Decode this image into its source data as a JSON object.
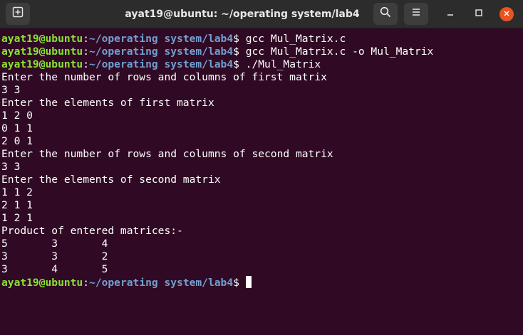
{
  "window": {
    "title": "ayat19@ubuntu: ~/operating system/lab4"
  },
  "toolbar": {
    "new_tab_icon": "new-tab-icon",
    "search_icon": "search-icon",
    "menu_icon": "hamburger-menu-icon",
    "minimize_icon": "minimize-icon",
    "maximize_icon": "maximize-icon",
    "close_icon": "close-icon",
    "close_color": "#e95420"
  },
  "prompt": {
    "user": "ayat19@ubuntu",
    "colon": ":",
    "path": "~/operating system/lab4",
    "dollar": "$ "
  },
  "colors": {
    "background": "#300a24",
    "prompt_user": "#8ae234",
    "prompt_path": "#729fcf",
    "text": "#ffffff"
  },
  "terminal": {
    "lines": [
      {
        "type": "prompt",
        "command": "gcc Mul_Matrix.c"
      },
      {
        "type": "prompt",
        "command": "gcc Mul_Matrix.c -o Mul_Matrix"
      },
      {
        "type": "prompt",
        "command": "./Mul_Matrix"
      },
      {
        "type": "output",
        "text": "Enter the number of rows and columns of first matrix"
      },
      {
        "type": "output",
        "text": "3 3"
      },
      {
        "type": "output",
        "text": "Enter the elements of first matrix"
      },
      {
        "type": "output",
        "text": "1 2 0"
      },
      {
        "type": "output",
        "text": "0 1 1"
      },
      {
        "type": "output",
        "text": "2 0 1"
      },
      {
        "type": "output",
        "text": "Enter the number of rows and columns of second matrix"
      },
      {
        "type": "output",
        "text": "3 3"
      },
      {
        "type": "output",
        "text": "Enter the elements of second matrix"
      },
      {
        "type": "output",
        "text": "1 1 2"
      },
      {
        "type": "output",
        "text": "2 1 1"
      },
      {
        "type": "output",
        "text": "1 2 1"
      },
      {
        "type": "output",
        "text": "Product of entered matrices:-"
      },
      {
        "type": "output",
        "text": "5\t3\t4"
      },
      {
        "type": "output",
        "text": "3\t3\t2"
      },
      {
        "type": "output",
        "text": "3\t4\t5"
      },
      {
        "type": "prompt",
        "command": "",
        "cursor": true
      }
    ]
  }
}
